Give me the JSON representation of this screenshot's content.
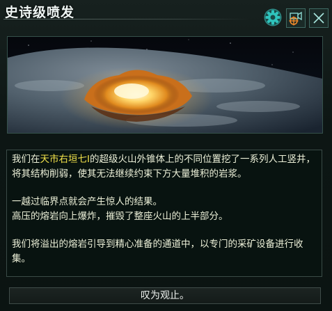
{
  "window": {
    "title": "史诗级喷发"
  },
  "toolbar": {
    "settings_icon": "gear-icon",
    "camera_icon": "camera-target-icon",
    "close_icon": "close-icon"
  },
  "event_image": {
    "subject": "volcanic-eruption-on-planet"
  },
  "description": {
    "p1_before": "我们在",
    "p1_highlight": "天市右垣七I",
    "p1_after": "的超级火山外锥体上的不同位置挖了一系列人工竖井，将其结构削弱，使其无法继续约束下方大量堆积的岩浆。",
    "p2_line1": "一越过临界点就会产生惊人的结果。",
    "p2_line2": "高压的熔岩向上爆炸，摧毁了整座火山的上半部分。",
    "p3": "我们将溢出的熔岩引导到精心准备的通道中，以专门的采矿设备进行收集。"
  },
  "actions": {
    "confirm_label": "叹为观止。"
  },
  "colors": {
    "highlight": "#f2e24a",
    "text": "#ecf0d8",
    "accent": "#3f6a63"
  }
}
